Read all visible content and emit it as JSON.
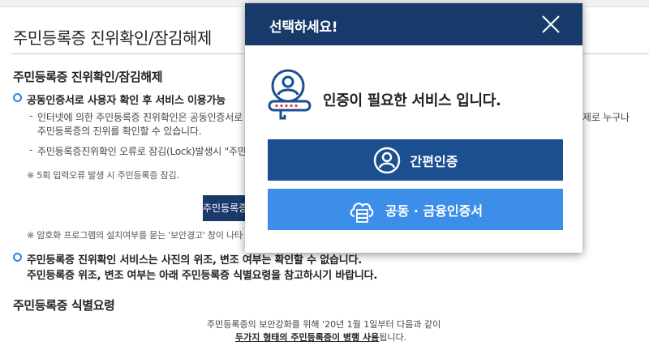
{
  "page": {
    "title": "주민등록증 진위확인/잠김해제",
    "section1": {
      "heading": "주민등록증 진위확인/잠김해제",
      "bullet1": "공동인증서로 사용자 확인 후 서비스 이용가능",
      "item1_line1": "인터넷에 의한 주민등록증 진위확인은 공동인증서로 본인",
      "item1_line1_tail": "제로 누구나",
      "item1_line2": "주민등록증의 진위를 확인할 수 있습니다.",
      "item2": "주민등록증진위확인 오류로 잠김(Lock)발생시 \"주민등록",
      "note1": "※ 5회 입력오류 발생 시 주민등록증 잠김.",
      "button_label": "주민등록증 진위확인",
      "note2": "※ 암호화 프로그램의 설치여부를 묻는 '보안경고' 창이 나타",
      "bullet2_line1": "주민등록증 진위확인 서비스는 사진의 위조, 변조 여부는 확인할 수 없습니다.",
      "bullet2_line2": "주민등록증 위조, 변조 여부는 아래 주민등록증 식별요령을 참고하시기 바랍니다."
    },
    "section2": {
      "heading": "주민등록증 식별요령",
      "line1": "주민등록증의 보안강화를 위해 '20년 1월 1일부터 다음과 같이",
      "line2_bold": "두가지 형태의 주민등록증이 병행 사용",
      "line2_tail": "됩니다."
    }
  },
  "modal": {
    "title": "선택하세요!",
    "close_icon": "close-icon",
    "notice": "인증이 필요한 서비스 입니다.",
    "buttons": [
      {
        "label": "간편인증",
        "icon": "user-circle-icon",
        "color": "#1c4f8f"
      },
      {
        "label": "공동 · 금융인증서",
        "icon": "cloud-server-icon",
        "color": "#3d8ee8"
      }
    ]
  },
  "colors": {
    "header": "#183a6b",
    "accent": "#1e88e5",
    "button_dark": "#1c4f8f",
    "button_light": "#3d8ee8"
  }
}
